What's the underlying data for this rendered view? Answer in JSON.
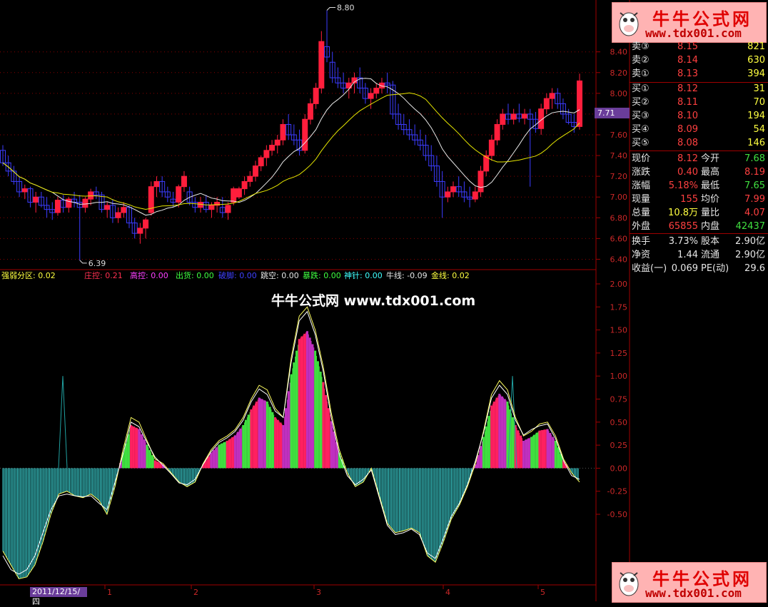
{
  "colors": {
    "up": "#ff1e3c",
    "down": "#3c3cff",
    "ma_short": "#e8e8e8",
    "ma_long": "#e6e600",
    "grid": "#8b0000",
    "axis_text": "#cc2828"
  },
  "price_axis_ticks": [
    "8.40",
    "8.20",
    "8.00",
    "7.80",
    "7.60",
    "7.40",
    "7.20",
    "7.00",
    "6.80",
    "6.60",
    "6.40"
  ],
  "current_price_tag": "7.71",
  "high_marker": "8.80",
  "low_marker": "6.39",
  "indicator_axis_ticks": [
    "2.00",
    "1.75",
    "1.50",
    "1.25",
    "1.00",
    "0.75",
    "0.50",
    "0.25",
    "0.00",
    "-0.25",
    "-0.50"
  ],
  "indicator_labels": [
    {
      "text": "强弱分区: 0.02",
      "color": "#ffff40"
    },
    {
      "text": "庄控: 0.21",
      "color": "#ff3050"
    },
    {
      "text": "高控: 0.00",
      "color": "#ff40ff"
    },
    {
      "text": "出货: 0.00",
      "color": "#40ff40"
    },
    {
      "text": "破脚: 0.00",
      "color": "#4040ff"
    },
    {
      "text": "跳空: 0.00",
      "color": "#e6e6e6"
    },
    {
      "text": "暴跌: 0.00",
      "color": "#40ff40"
    },
    {
      "text": "神针: 0.00",
      "color": "#40ffff"
    },
    {
      "text": "牛线: -0.09",
      "color": "#e6e6e6"
    },
    {
      "text": "金线: 0.02",
      "color": "#ffff40"
    }
  ],
  "watermark_center": "牛牛公式网 www.tdx001.com",
  "watermark_logo": {
    "title": "牛牛公式网",
    "url": "www.tdx001.com"
  },
  "date_box": "2011/12/15/四",
  "month_ticks": [
    "1",
    "2",
    "3",
    "4",
    "5"
  ],
  "order_book": [
    {
      "label": "卖③",
      "price": "8.15",
      "vol": "821"
    },
    {
      "label": "卖②",
      "price": "8.14",
      "vol": "630"
    },
    {
      "label": "卖①",
      "price": "8.13",
      "vol": "394"
    },
    {
      "label": "买①",
      "price": "8.12",
      "vol": "31"
    },
    {
      "label": "买②",
      "price": "8.11",
      "vol": "70"
    },
    {
      "label": "买③",
      "price": "8.10",
      "vol": "194"
    },
    {
      "label": "买④",
      "price": "8.09",
      "vol": "54"
    },
    {
      "label": "买⑤",
      "price": "8.08",
      "vol": "146"
    }
  ],
  "quote": [
    {
      "l1": "现价",
      "v1": "8.12",
      "c1": "#ff4040",
      "l2": "今开",
      "v2": "7.68",
      "c2": "#40e040"
    },
    {
      "l1": "涨跌",
      "v1": "0.40",
      "c1": "#ff4040",
      "l2": "最高",
      "v2": "8.19",
      "c2": "#ff4040"
    },
    {
      "l1": "涨幅",
      "v1": "5.18%",
      "c1": "#ff4040",
      "l2": "最低",
      "v2": "7.65",
      "c2": "#40e040"
    },
    {
      "l1": "现量",
      "v1": "155",
      "c1": "#ff4040",
      "l2": "均价",
      "v2": "7.99",
      "c2": "#ff4040"
    },
    {
      "l1": "总量",
      "v1": "10.8万",
      "c1": "#ffff40",
      "l2": "量比",
      "v2": "4.07",
      "c2": "#ff4040"
    },
    {
      "l1": "外盘",
      "v1": "65855",
      "c1": "#ff4040",
      "l2": "内盘",
      "v2": "42437",
      "c2": "#40e040"
    }
  ],
  "fundamentals": [
    {
      "l1": "换手",
      "v1": "3.73%",
      "l2": "股本",
      "v2": "2.90亿"
    },
    {
      "l1": "净资",
      "v1": "1.44",
      "l2": "流通",
      "v2": "2.90亿"
    },
    {
      "l1": "收益(一)",
      "v1": "0.069",
      "l2": "PE(动)",
      "v2": "29.6"
    }
  ],
  "chart_data": {
    "type": "candlestick",
    "ylim": [
      6.3,
      8.9
    ],
    "candles": [
      [
        7.45,
        7.5,
        7.3,
        7.33
      ],
      [
        7.33,
        7.4,
        7.2,
        7.25
      ],
      [
        7.25,
        7.3,
        7.12,
        7.15
      ],
      [
        7.15,
        7.2,
        7.0,
        7.05
      ],
      [
        7.05,
        7.12,
        6.98,
        7.08
      ],
      [
        7.08,
        7.1,
        6.9,
        6.95
      ],
      [
        6.95,
        7.05,
        6.85,
        7.0
      ],
      [
        7.0,
        7.05,
        6.9,
        6.92
      ],
      [
        6.92,
        7.0,
        6.8,
        6.88
      ],
      [
        6.88,
        6.95,
        6.78,
        6.85
      ],
      [
        6.85,
        7.0,
        6.82,
        6.97
      ],
      [
        6.97,
        7.02,
        6.85,
        6.9
      ],
      [
        6.9,
        7.0,
        6.85,
        6.98
      ],
      [
        6.98,
        7.05,
        6.9,
        6.95
      ],
      [
        6.95,
        7.02,
        6.39,
        6.9
      ],
      [
        6.9,
        7.0,
        6.85,
        6.98
      ],
      [
        6.98,
        7.08,
        6.92,
        7.05
      ],
      [
        7.05,
        7.1,
        6.98,
        7.02
      ],
      [
        7.02,
        7.05,
        6.85,
        6.88
      ],
      [
        6.88,
        6.95,
        6.8,
        6.92
      ],
      [
        6.92,
        6.98,
        6.75,
        6.8
      ],
      [
        6.8,
        6.9,
        6.75,
        6.85
      ],
      [
        6.85,
        6.95,
        6.8,
        6.9
      ],
      [
        6.9,
        6.92,
        6.7,
        6.75
      ],
      [
        6.75,
        6.8,
        6.6,
        6.65
      ],
      [
        6.65,
        6.75,
        6.55,
        6.7
      ],
      [
        6.7,
        6.8,
        6.6,
        6.78
      ],
      [
        6.85,
        7.15,
        6.82,
        7.1
      ],
      [
        7.1,
        7.2,
        7.0,
        7.15
      ],
      [
        7.15,
        7.2,
        7.0,
        7.05
      ],
      [
        7.05,
        7.1,
        6.95,
        7.0
      ],
      [
        6.98,
        7.05,
        6.9,
        6.95
      ],
      [
        6.95,
        7.12,
        6.9,
        7.1
      ],
      [
        7.1,
        7.25,
        7.05,
        7.2
      ],
      [
        7.05,
        7.1,
        6.92,
        6.95
      ],
      [
        6.95,
        7.0,
        6.85,
        6.9
      ],
      [
        6.9,
        7.0,
        6.85,
        6.95
      ],
      [
        6.95,
        7.02,
        6.85,
        6.88
      ],
      [
        6.88,
        6.95,
        6.8,
        6.92
      ],
      [
        6.92,
        7.0,
        6.85,
        6.95
      ],
      [
        6.9,
        7.0,
        6.8,
        6.85
      ],
      [
        6.85,
        6.95,
        6.78,
        6.92
      ],
      [
        6.95,
        7.1,
        6.92,
        7.08
      ],
      [
        7.0,
        7.1,
        6.98,
        7.08
      ],
      [
        7.08,
        7.2,
        7.02,
        7.15
      ],
      [
        7.15,
        7.25,
        7.1,
        7.2
      ],
      [
        7.2,
        7.35,
        7.15,
        7.3
      ],
      [
        7.3,
        7.4,
        7.25,
        7.38
      ],
      [
        7.38,
        7.5,
        7.3,
        7.45
      ],
      [
        7.45,
        7.55,
        7.4,
        7.5
      ],
      [
        7.5,
        7.6,
        7.42,
        7.55
      ],
      [
        7.55,
        7.75,
        7.5,
        7.7
      ],
      [
        7.7,
        7.8,
        7.55,
        7.6
      ],
      [
        7.6,
        7.7,
        7.5,
        7.55
      ],
      [
        7.55,
        7.65,
        7.4,
        7.45
      ],
      [
        7.45,
        7.8,
        7.42,
        7.75
      ],
      [
        7.75,
        7.95,
        7.7,
        7.9
      ],
      [
        7.9,
        8.1,
        7.85,
        8.05
      ],
      [
        8.05,
        8.6,
        8.0,
        8.5
      ],
      [
        8.45,
        8.8,
        8.3,
        8.35
      ],
      [
        8.3,
        8.4,
        8.1,
        8.15
      ],
      [
        8.15,
        8.25,
        8.05,
        8.1
      ],
      [
        8.1,
        8.2,
        8.0,
        8.05
      ],
      [
        8.05,
        8.15,
        7.95,
        8.1
      ],
      [
        8.1,
        8.2,
        8.0,
        8.15
      ],
      [
        8.15,
        8.25,
        8.0,
        8.05
      ],
      [
        8.05,
        8.1,
        7.9,
        7.95
      ],
      [
        7.95,
        8.05,
        7.85,
        8.0
      ],
      [
        8.0,
        8.1,
        7.95,
        8.05
      ],
      [
        8.05,
        8.15,
        8.0,
        8.1
      ],
      [
        8.1,
        8.2,
        8.0,
        8.08
      ],
      [
        8.08,
        8.12,
        7.75,
        7.8
      ],
      [
        7.8,
        7.9,
        7.65,
        7.7
      ],
      [
        7.7,
        7.8,
        7.6,
        7.65
      ],
      [
        7.65,
        7.75,
        7.55,
        7.6
      ],
      [
        7.6,
        7.7,
        7.5,
        7.55
      ],
      [
        7.55,
        7.65,
        7.45,
        7.5
      ],
      [
        7.5,
        7.6,
        7.35,
        7.4
      ],
      [
        7.4,
        7.5,
        7.25,
        7.3
      ],
      [
        7.3,
        7.4,
        7.1,
        7.15
      ],
      [
        7.15,
        7.25,
        6.8,
        7.0
      ],
      [
        7.0,
        7.1,
        6.95,
        7.05
      ],
      [
        7.05,
        7.15,
        7.0,
        7.1
      ],
      [
        7.1,
        7.2,
        7.0,
        7.05
      ],
      [
        7.05,
        7.15,
        6.95,
        7.0
      ],
      [
        7.0,
        7.1,
        6.9,
        6.98
      ],
      [
        6.98,
        7.1,
        6.95,
        7.05
      ],
      [
        7.05,
        7.3,
        7.0,
        7.25
      ],
      [
        7.25,
        7.45,
        7.2,
        7.4
      ],
      [
        7.4,
        7.6,
        7.35,
        7.55
      ],
      [
        7.55,
        7.75,
        7.5,
        7.7
      ],
      [
        7.7,
        7.85,
        7.65,
        7.8
      ],
      [
        7.8,
        7.9,
        7.7,
        7.75
      ],
      [
        7.75,
        7.85,
        7.7,
        7.8
      ],
      [
        7.8,
        7.9,
        7.72,
        7.76
      ],
      [
        7.76,
        7.85,
        7.7,
        7.8
      ],
      [
        7.8,
        7.85,
        7.1,
        7.75
      ],
      [
        7.75,
        7.82,
        7.62,
        7.66
      ],
      [
        7.66,
        7.9,
        7.6,
        7.85
      ],
      [
        7.85,
        8.0,
        7.8,
        7.95
      ],
      [
        7.95,
        8.05,
        7.85,
        8.0
      ],
      [
        8.0,
        8.05,
        7.85,
        7.9
      ],
      [
        7.9,
        7.95,
        7.75,
        7.8
      ],
      [
        7.8,
        7.85,
        7.7,
        7.72
      ],
      [
        7.72,
        7.8,
        7.62,
        7.68
      ],
      [
        7.68,
        8.19,
        7.65,
        8.12
      ]
    ],
    "indicator": {
      "type": "oscillator",
      "line": [
        -0.9,
        -1.05,
        -1.2,
        -1.18,
        -1.05,
        -0.8,
        -0.5,
        -0.28,
        -0.25,
        -0.3,
        -0.32,
        -0.28,
        -0.35,
        -0.5,
        -0.2,
        0.2,
        0.55,
        0.5,
        0.3,
        0.1,
        0.05,
        -0.05,
        -0.15,
        -0.2,
        -0.15,
        0.05,
        0.2,
        0.3,
        0.35,
        0.42,
        0.55,
        0.75,
        0.9,
        0.85,
        0.65,
        0.55,
        1.2,
        1.65,
        1.75,
        1.5,
        1.1,
        0.6,
        0.2,
        -0.05,
        -0.2,
        -0.15,
        0.0,
        -0.3,
        -0.6,
        -0.7,
        -0.68,
        -0.65,
        -0.7,
        -0.95,
        -1.02,
        -0.8,
        -0.55,
        -0.4,
        -0.2,
        0.05,
        0.4,
        0.8,
        0.95,
        0.85,
        0.55,
        0.35,
        0.4,
        0.48,
        0.5,
        0.35,
        0.1,
        -0.05,
        -0.15
      ],
      "overlay_line": [
        -0.95,
        -1.1,
        -1.15,
        -1.1,
        -0.95,
        -0.7,
        -0.45,
        -0.3,
        -0.28,
        -0.3,
        -0.31,
        -0.3,
        -0.38,
        -0.45,
        -0.15,
        0.15,
        0.5,
        0.45,
        0.28,
        0.12,
        0.03,
        -0.06,
        -0.16,
        -0.18,
        -0.12,
        0.04,
        0.18,
        0.28,
        0.33,
        0.4,
        0.52,
        0.72,
        0.86,
        0.8,
        0.62,
        0.55,
        1.15,
        1.6,
        1.7,
        1.45,
        1.05,
        0.55,
        0.15,
        -0.08,
        -0.18,
        -0.12,
        -0.02,
        -0.32,
        -0.62,
        -0.72,
        -0.7,
        -0.66,
        -0.72,
        -0.92,
        -0.98,
        -0.76,
        -0.52,
        -0.38,
        -0.18,
        0.08,
        0.38,
        0.76,
        0.9,
        0.8,
        0.52,
        0.36,
        0.42,
        0.46,
        0.48,
        0.32,
        0.08,
        -0.08,
        -0.12
      ]
    }
  }
}
